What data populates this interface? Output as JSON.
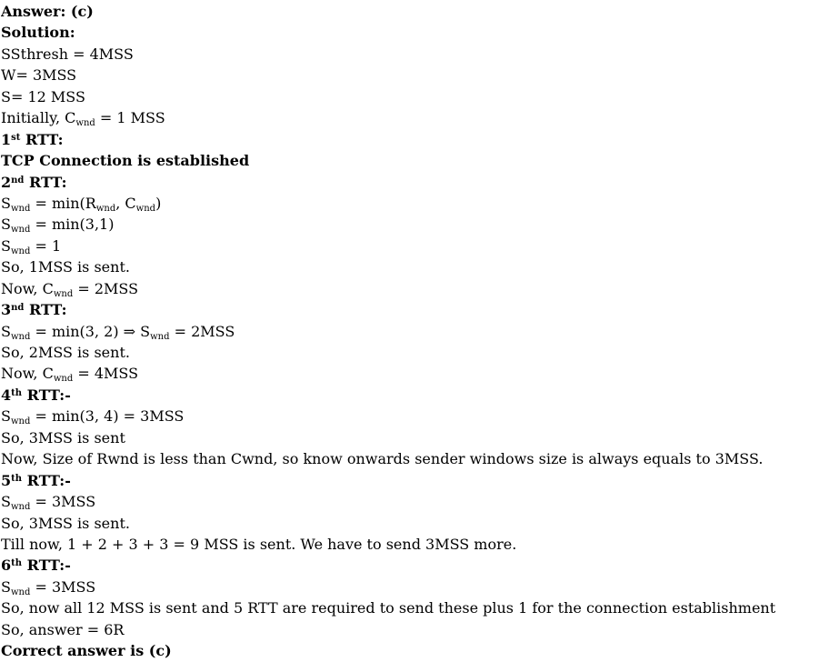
{
  "lines": [
    {
      "name": "answer-heading",
      "bold": true,
      "parts": [
        {
          "t": "Answer: (c)"
        }
      ]
    },
    {
      "name": "solution-heading",
      "bold": true,
      "parts": [
        {
          "t": "Solution:"
        }
      ]
    },
    {
      "name": "given-ssthresh",
      "parts": [
        {
          "t": "SSthresh = 4MSS"
        }
      ]
    },
    {
      "name": "given-w",
      "parts": [
        {
          "t": "W= 3MSS"
        }
      ]
    },
    {
      "name": "given-s",
      "parts": [
        {
          "t": "S= 12 MSS"
        }
      ]
    },
    {
      "name": "initial-cwnd",
      "parts": [
        {
          "t": "Initially, C"
        },
        {
          "t": "wnd",
          "sub": true
        },
        {
          "t": " = 1 MSS"
        }
      ]
    },
    {
      "name": "rtt1-heading",
      "bold": true,
      "parts": [
        {
          "t": "1"
        },
        {
          "t": "st",
          "sup": true
        },
        {
          "t": " RTT:"
        }
      ]
    },
    {
      "name": "rtt1-note",
      "bold": true,
      "parts": [
        {
          "t": "TCP Connection is established"
        }
      ]
    },
    {
      "name": "rtt2-heading",
      "bold": true,
      "parts": [
        {
          "t": "2"
        },
        {
          "t": "nd",
          "sup": true
        },
        {
          "t": " RTT:"
        }
      ]
    },
    {
      "name": "rtt2-line1",
      "parts": [
        {
          "t": "S"
        },
        {
          "t": "wnd",
          "sub": true
        },
        {
          "t": " = min(R"
        },
        {
          "t": "wnd",
          "sub": true
        },
        {
          "t": ", C"
        },
        {
          "t": "wnd",
          "sub": true
        },
        {
          "t": ")"
        }
      ]
    },
    {
      "name": "rtt2-line2",
      "parts": [
        {
          "t": "S"
        },
        {
          "t": "wnd",
          "sub": true
        },
        {
          "t": " = min(3,1)"
        }
      ]
    },
    {
      "name": "rtt2-line3",
      "parts": [
        {
          "t": "S"
        },
        {
          "t": "wnd",
          "sub": true
        },
        {
          "t": " = 1"
        }
      ]
    },
    {
      "name": "rtt2-line4",
      "parts": [
        {
          "t": "So, 1MSS is sent."
        }
      ]
    },
    {
      "name": "rtt2-line5",
      "parts": [
        {
          "t": "Now, C"
        },
        {
          "t": "wnd",
          "sub": true
        },
        {
          "t": " = 2MSS"
        }
      ]
    },
    {
      "name": "rtt3-heading",
      "bold": true,
      "parts": [
        {
          "t": "3"
        },
        {
          "t": "nd",
          "sup": true
        },
        {
          "t": " RTT:"
        }
      ]
    },
    {
      "name": "rtt3-line1",
      "parts": [
        {
          "t": "S"
        },
        {
          "t": "wnd",
          "sub": true
        },
        {
          "t": " = min(3, 2) ⇒ S"
        },
        {
          "t": "wnd",
          "sub": true
        },
        {
          "t": " = 2MSS"
        }
      ]
    },
    {
      "name": "rtt3-line2",
      "parts": [
        {
          "t": "So, 2MSS is sent."
        }
      ]
    },
    {
      "name": "rtt3-line3",
      "parts": [
        {
          "t": "Now, C"
        },
        {
          "t": "wnd",
          "sub": true
        },
        {
          "t": " = 4MSS"
        }
      ]
    },
    {
      "name": "rtt4-heading",
      "bold": true,
      "parts": [
        {
          "t": "4"
        },
        {
          "t": "th",
          "sup": true
        },
        {
          "t": " RTT:-"
        }
      ]
    },
    {
      "name": "rtt4-line1",
      "parts": [
        {
          "t": "S"
        },
        {
          "t": "wnd",
          "sub": true
        },
        {
          "t": " = min(3, 4) = 3MSS"
        }
      ]
    },
    {
      "name": "rtt4-line2",
      "parts": [
        {
          "t": "So, 3MSS is sent"
        }
      ]
    },
    {
      "name": "rtt4-line3",
      "parts": [
        {
          "t": "Now, Size of Rwnd is less than Cwnd, so know onwards sender windows size is always equals to 3MSS."
        }
      ]
    },
    {
      "name": "rtt5-heading",
      "bold": true,
      "parts": [
        {
          "t": "5"
        },
        {
          "t": "th",
          "sup": true
        },
        {
          "t": " RTT:-"
        }
      ]
    },
    {
      "name": "rtt5-line1",
      "parts": [
        {
          "t": "S"
        },
        {
          "t": "wnd",
          "sub": true
        },
        {
          "t": " = 3MSS"
        }
      ]
    },
    {
      "name": "rtt5-line2",
      "parts": [
        {
          "t": "So, 3MSS is sent."
        }
      ]
    },
    {
      "name": "rtt5-line3",
      "parts": [
        {
          "t": "Till now, 1 + 2 + 3 + 3 = 9 MSS is sent. We have to send 3MSS more."
        }
      ]
    },
    {
      "name": "rtt6-heading",
      "bold": true,
      "parts": [
        {
          "t": "6"
        },
        {
          "t": "th",
          "sup": true
        },
        {
          "t": " RTT:-"
        }
      ]
    },
    {
      "name": "rtt6-line1",
      "parts": [
        {
          "t": "S"
        },
        {
          "t": "wnd",
          "sub": true
        },
        {
          "t": " = 3MSS"
        }
      ]
    },
    {
      "name": "rtt6-line2",
      "parts": [
        {
          "t": "So, now all 12 MSS is sent and 5 RTT are required to send these plus 1 for the connection establishment"
        }
      ]
    },
    {
      "name": "final-answer-line",
      "parts": [
        {
          "t": "So, answer = 6R"
        }
      ]
    },
    {
      "name": "correct-answer",
      "bold": true,
      "parts": [
        {
          "t": "Correct answer is (c)"
        }
      ]
    }
  ]
}
